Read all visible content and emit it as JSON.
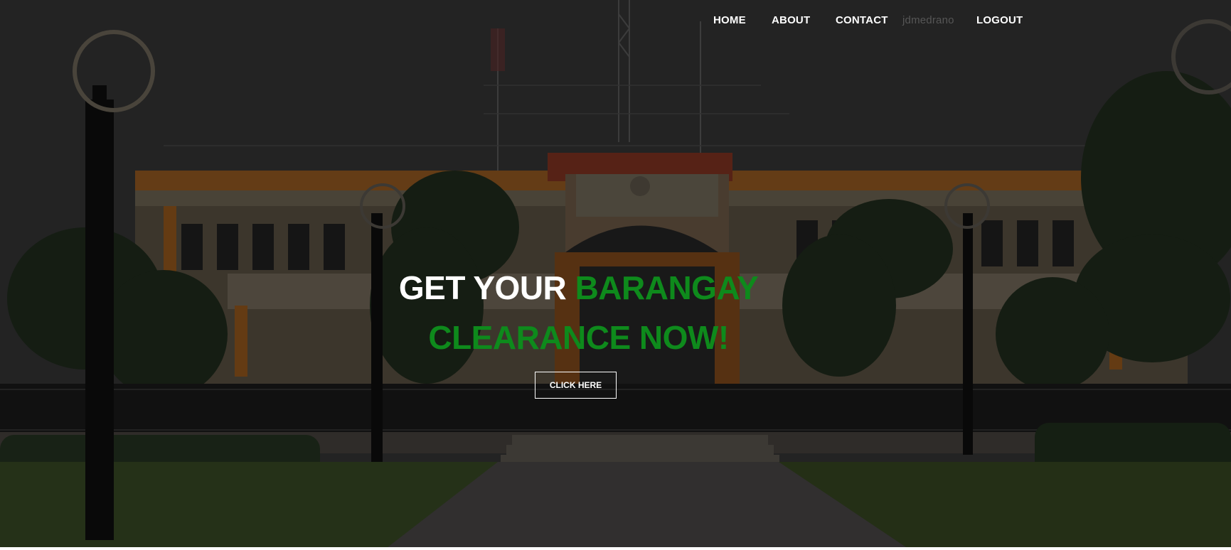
{
  "nav": {
    "items": [
      {
        "label": "HOME"
      },
      {
        "label": "ABOUT"
      },
      {
        "label": "CONTACT"
      }
    ],
    "username": "jdmedrano",
    "logout_label": "LOGOUT"
  },
  "hero": {
    "headline_part1": "GET YOUR ",
    "headline_part2": "BARANGAY",
    "headline_part3": "CLEARANCE NOW!",
    "cta_label": "CLICK HERE"
  },
  "colors": {
    "accent_green": "#0e8a1c",
    "nav_text": "#ffffff",
    "username_text": "#565656",
    "overlay": "#000000"
  }
}
